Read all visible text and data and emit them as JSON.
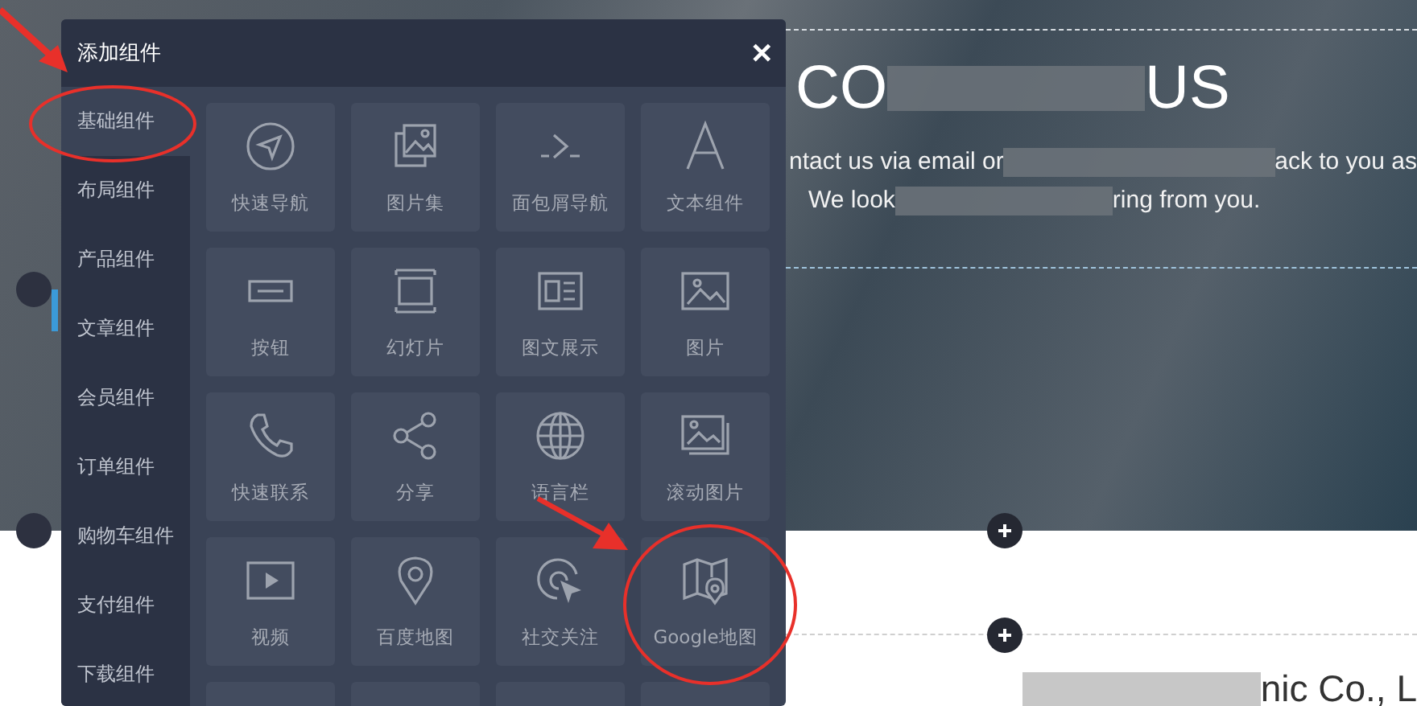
{
  "dialog": {
    "title": "添加组件",
    "close": "✕"
  },
  "sidebar": {
    "items": [
      {
        "label": "基础组件",
        "selected": true
      },
      {
        "label": "布局组件",
        "selected": false
      },
      {
        "label": "产品组件",
        "selected": false
      },
      {
        "label": "文章组件",
        "selected": false
      },
      {
        "label": "会员组件",
        "selected": false
      },
      {
        "label": "订单组件",
        "selected": false
      },
      {
        "label": "购物车组件",
        "selected": false
      },
      {
        "label": "支付组件",
        "selected": false
      },
      {
        "label": "下载组件",
        "selected": false
      }
    ]
  },
  "tiles": [
    {
      "kind": "navigation",
      "label": "快速导航"
    },
    {
      "kind": "gallery",
      "label": "图片集"
    },
    {
      "kind": "breadcrumb",
      "label": "面包屑导航"
    },
    {
      "kind": "text",
      "label": "文本组件"
    },
    {
      "kind": "button",
      "label": "按钮"
    },
    {
      "kind": "slides",
      "label": "幻灯片"
    },
    {
      "kind": "article",
      "label": "图文展示"
    },
    {
      "kind": "image",
      "label": "图片"
    },
    {
      "kind": "contact",
      "label": "快速联系"
    },
    {
      "kind": "share",
      "label": "分享"
    },
    {
      "kind": "language",
      "label": "语言栏"
    },
    {
      "kind": "carousel",
      "label": "滚动图片"
    },
    {
      "kind": "video",
      "label": "视频"
    },
    {
      "kind": "baidumap",
      "label": "百度地图"
    },
    {
      "kind": "social",
      "label": "社交关注"
    },
    {
      "kind": "googlemap",
      "label": "Google地图"
    },
    {
      "kind": "empty"
    },
    {
      "kind": "empty"
    },
    {
      "kind": "empty"
    },
    {
      "kind": "empty"
    }
  ],
  "page": {
    "heading": [
      {
        "text": "CO"
      },
      {
        "text": "US"
      }
    ],
    "line_1": [
      {
        "text": "ntact us via email or"
      },
      {
        "text": "ack to you as"
      }
    ],
    "line_2": [
      {
        "text": "We look"
      },
      {
        "text": "ring from you."
      }
    ],
    "footer_text": "nic Co., L"
  }
}
